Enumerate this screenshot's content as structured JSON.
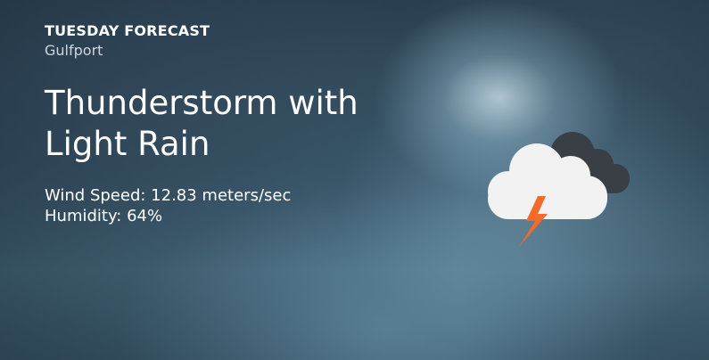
{
  "forecast": {
    "day_label": "TUESDAY FORECAST",
    "city": "Gulfport",
    "condition": "Thunderstorm with Light Rain",
    "wind_speed": "Wind Speed: 12.83 meters/sec",
    "humidity": "Humidity: 64%"
  },
  "icon": {
    "name": "thunderstorm-icon",
    "colors": {
      "front_cloud": "#f2f2f2",
      "back_cloud": "#3a3f45",
      "lightning": "#f26a2c"
    }
  }
}
